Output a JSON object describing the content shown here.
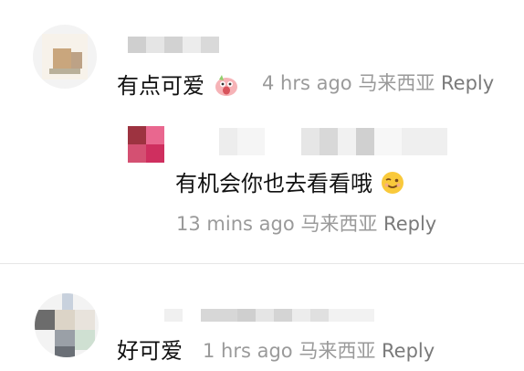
{
  "comments": [
    {
      "text": "有点可爱",
      "time": "4 hrs ago",
      "location": "马来西亚",
      "reply_label": "Reply",
      "emoji": "pig-face-icon"
    },
    {
      "text": "有机会你也去看看哦",
      "time": "13 mins ago",
      "location": "马来西亚",
      "reply_label": "Reply",
      "emoji": "winking-face-icon"
    },
    {
      "text": "好可爱",
      "time": "1 hrs ago",
      "location": "马来西亚",
      "reply_label": "Reply"
    }
  ]
}
